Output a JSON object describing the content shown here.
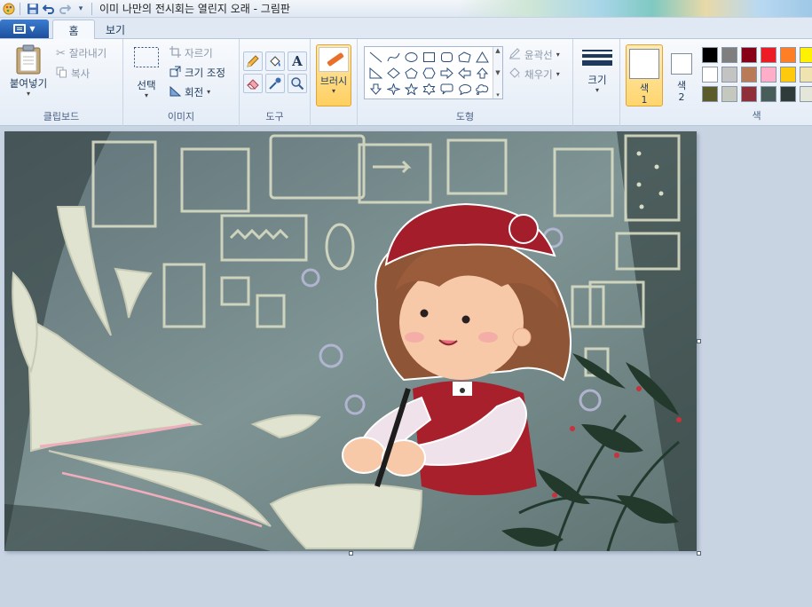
{
  "window": {
    "title": "이미 나만의 전시회는 열린지 오래 - 그림판"
  },
  "tabs": {
    "home": "홈",
    "view": "보기"
  },
  "clipboard": {
    "paste": "붙여넣기",
    "cut": "잘라내기",
    "copy": "복사",
    "label": "클립보드"
  },
  "image": {
    "select": "선택",
    "crop": "자르기",
    "resize": "크기 조정",
    "rotate": "회전",
    "label": "이미지"
  },
  "tools": {
    "label": "도구",
    "items": [
      "pencil-icon",
      "fill-icon",
      "text-icon",
      "eraser-icon",
      "color-picker-icon",
      "magnifier-icon"
    ]
  },
  "brush": {
    "label": "브러시"
  },
  "shapes": {
    "outline": "윤곽선",
    "fill": "채우기",
    "label": "도형"
  },
  "size": {
    "label": "크기"
  },
  "colors": {
    "color1_label": "색",
    "color1_num": "1",
    "color2_label": "색",
    "color2_num": "2",
    "label": "색",
    "palette": [
      "#000000",
      "#7f7f7f",
      "#880015",
      "#ed1c24",
      "#ff7f27",
      "#fff200",
      "#ffffff",
      "#c3c3c3",
      "#b97a57",
      "#ffaec9",
      "#ffc90e",
      "#efe4b0",
      "#5b5a2a",
      "#c4c8bf",
      "#8e2f3a",
      "#485c5a",
      "#2f3b3a",
      "#e3e6d9"
    ]
  }
}
